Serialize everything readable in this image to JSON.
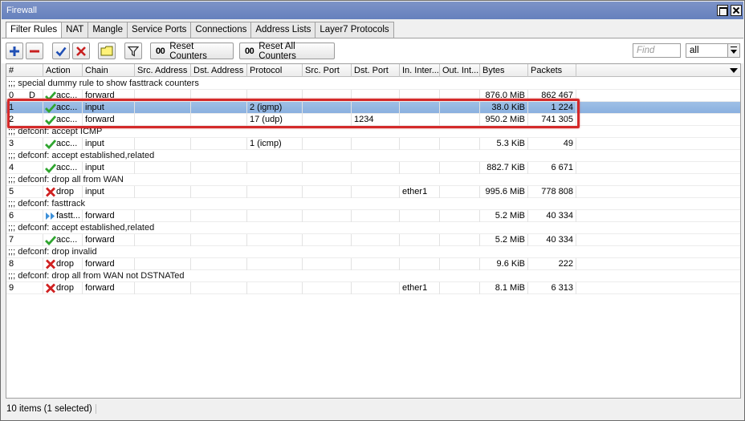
{
  "window": {
    "title": "Firewall"
  },
  "tabs": [
    "Filter Rules",
    "NAT",
    "Mangle",
    "Service Ports",
    "Connections",
    "Address Lists",
    "Layer7 Protocols"
  ],
  "toolbar": {
    "reset_counters": "Reset Counters",
    "reset_all_counters": "Reset All Counters",
    "counter_icon": "00",
    "find_placeholder": "Find",
    "filter_value": "all"
  },
  "columns": [
    "#",
    "Action",
    "Chain",
    "Src. Address",
    "Dst. Address",
    "Protocol",
    "Src. Port",
    "Dst. Port",
    "In. Inter...",
    "Out. Int...",
    "Bytes",
    "Packets"
  ],
  "rows": [
    {
      "type": "comment",
      "text": ";;; special dummy rule to show fasttrack counters"
    },
    {
      "type": "rule",
      "num": "0",
      "flag": "D",
      "action_icon": "check-icon",
      "action": "acc...",
      "chain": "forward",
      "protocol": "",
      "dst_port": "",
      "in_iface": "",
      "bytes": "876.0 MiB",
      "packets": "862 467"
    },
    {
      "type": "rule",
      "num": "1",
      "flag": "",
      "action_icon": "check-icon",
      "action": "acc...",
      "chain": "input",
      "protocol": "2 (igmp)",
      "dst_port": "",
      "in_iface": "",
      "bytes": "38.0 KiB",
      "packets": "1 224",
      "selected": true
    },
    {
      "type": "rule",
      "num": "2",
      "flag": "",
      "action_icon": "check-icon",
      "action": "acc...",
      "chain": "forward",
      "protocol": "17 (udp)",
      "dst_port": "1234",
      "in_iface": "",
      "bytes": "950.2 MiB",
      "packets": "741 305"
    },
    {
      "type": "comment",
      "text": ";;; defconf: accept ICMP"
    },
    {
      "type": "rule",
      "num": "3",
      "flag": "",
      "action_icon": "check-icon",
      "action": "acc...",
      "chain": "input",
      "protocol": "1 (icmp)",
      "dst_port": "",
      "in_iface": "",
      "bytes": "5.3 KiB",
      "packets": "49"
    },
    {
      "type": "comment",
      "text": ";;; defconf: accept established,related"
    },
    {
      "type": "rule",
      "num": "4",
      "flag": "",
      "action_icon": "check-icon",
      "action": "acc...",
      "chain": "input",
      "protocol": "",
      "dst_port": "",
      "in_iface": "",
      "bytes": "882.7 KiB",
      "packets": "6 671"
    },
    {
      "type": "comment",
      "text": ";;; defconf: drop all from WAN"
    },
    {
      "type": "rule",
      "num": "5",
      "flag": "",
      "action_icon": "cross-icon",
      "action": "drop",
      "chain": "input",
      "protocol": "",
      "dst_port": "",
      "in_iface": "ether1",
      "bytes": "995.6 MiB",
      "packets": "778 808"
    },
    {
      "type": "comment",
      "text": ";;; defconf: fasttrack"
    },
    {
      "type": "rule",
      "num": "6",
      "flag": "",
      "action_icon": "fasttrack-icon",
      "action": "fastt...",
      "chain": "forward",
      "protocol": "",
      "dst_port": "",
      "in_iface": "",
      "bytes": "5.2 MiB",
      "packets": "40 334"
    },
    {
      "type": "comment",
      "text": ";;; defconf: accept established,related"
    },
    {
      "type": "rule",
      "num": "7",
      "flag": "",
      "action_icon": "check-icon",
      "action": "acc...",
      "chain": "forward",
      "protocol": "",
      "dst_port": "",
      "in_iface": "",
      "bytes": "5.2 MiB",
      "packets": "40 334"
    },
    {
      "type": "comment",
      "text": ";;; defconf: drop invalid"
    },
    {
      "type": "rule",
      "num": "8",
      "flag": "",
      "action_icon": "cross-icon",
      "action": "drop",
      "chain": "forward",
      "protocol": "",
      "dst_port": "",
      "in_iface": "",
      "bytes": "9.6 KiB",
      "packets": "222"
    },
    {
      "type": "comment",
      "text": ";;; defconf:  drop all from WAN not DSTNATed"
    },
    {
      "type": "rule",
      "num": "9",
      "flag": "",
      "action_icon": "cross-icon",
      "action": "drop",
      "chain": "forward",
      "protocol": "",
      "dst_port": "",
      "in_iface": "ether1",
      "bytes": "8.1 MiB",
      "packets": "6 313"
    }
  ],
  "status": {
    "text": "10 items (1 selected)"
  },
  "colors": {
    "title_bar": "#6f88c2",
    "selection": "#94b8e2",
    "highlight_box": "#d42a2a",
    "accept_green": "#2fa52f",
    "drop_red": "#d02020",
    "add_blue": "#1f4fb5"
  }
}
